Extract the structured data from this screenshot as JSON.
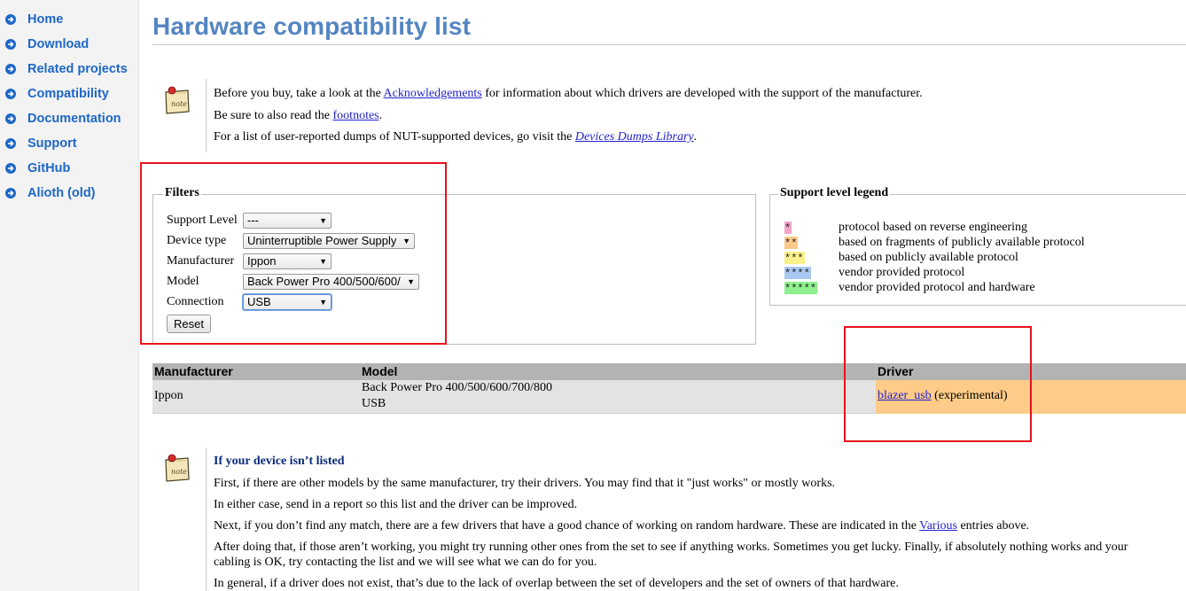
{
  "sidebar": {
    "items": [
      {
        "label": "Home"
      },
      {
        "label": "Download"
      },
      {
        "label": "Related projects"
      },
      {
        "label": "Compatibility"
      },
      {
        "label": "Documentation"
      },
      {
        "label": "Support"
      },
      {
        "label": "GitHub"
      },
      {
        "label": "Alioth (old)"
      }
    ]
  },
  "page": {
    "title": "Hardware compatibility list"
  },
  "intro_note": {
    "icon": "note-icon",
    "line1_pre": "Before you buy, take a look at the ",
    "line1_link": "Acknowledgements",
    "line1_post": " for information about which drivers are developed with the support of the manufacturer.",
    "line2_pre": "Be sure to also read the ",
    "line2_link": "footnotes",
    "line2_post": ".",
    "line3_pre": "For a list of user-reported dumps of NUT-supported devices, go visit the ",
    "line3_link": "Devices Dumps Library",
    "line3_post": "."
  },
  "filters": {
    "legend": "Filters",
    "support_level": {
      "label": "Support Level",
      "value": "---"
    },
    "device_type": {
      "label": "Device type",
      "value": "Uninterruptible Power Supply"
    },
    "manufacturer": {
      "label": "Manufacturer",
      "value": "Ippon"
    },
    "model": {
      "label": "Model",
      "value": "Back Power Pro 400/500/600/"
    },
    "connection": {
      "label": "Connection",
      "value": "USB"
    },
    "reset_label": "Reset"
  },
  "support_legend": {
    "legend": "Support level legend",
    "levels": [
      {
        "stars": "*",
        "color": "#f4a3c8",
        "text": "protocol based on reverse engineering"
      },
      {
        "stars": "**",
        "color": "#fcc98a",
        "text": "based on fragments of publicly available protocol"
      },
      {
        "stars": "***",
        "color": "#fbf08a",
        "text": "based on publicly available protocol"
      },
      {
        "stars": "****",
        "color": "#a9c8f2",
        "text": "vendor provided protocol"
      },
      {
        "stars": "*****",
        "color": "#8ef08e",
        "text": "vendor provided protocol and hardware"
      }
    ]
  },
  "results": {
    "headers": [
      "Manufacturer",
      "Model",
      "Driver"
    ],
    "rows": [
      {
        "manufacturer": "Ippon",
        "model_line1": "Back Power Pro 400/500/600/700/800",
        "model_line2": "USB",
        "driver_link": "blazer_usb",
        "driver_note": " (experimental)"
      }
    ]
  },
  "bottom_note": {
    "icon": "note-icon",
    "heading": "If your device isn’t listed",
    "p1": "First, if there are other models by the same manufacturer, try their drivers. You may find that it \"just works\" or mostly works.",
    "p2": "In either case, send in a report so this list and the driver can be improved.",
    "p3_pre": "Next, if you don’t find any match, there are a few drivers that have a good chance of working on random hardware. These are indicated in the ",
    "p3_link": "Various",
    "p3_post": " entries above.",
    "p4_line1": "After doing that, if those aren’t working, you might try running other ones from the set to see if anything works. Sometimes you get lucky. Finally, if absolutely nothing works and your",
    "p4_line2": "cabling is OK, try contacting the list and we will see what we can do for you.",
    "p5": "In general, if a driver does not exist, that’s due to the lack of overlap between the set of developers and the set of owners of that hardware."
  },
  "colors": {
    "nav_link": "#1d67c7",
    "title": "#5485c2",
    "annotation_red": "#e8121d",
    "driver_cell": "#fecc88"
  }
}
